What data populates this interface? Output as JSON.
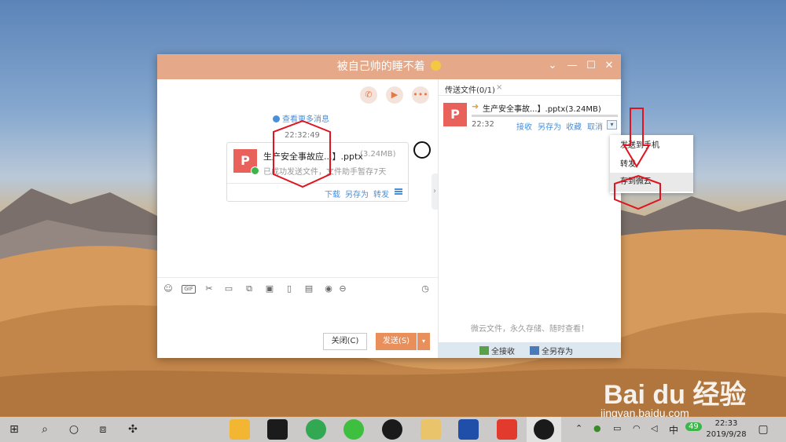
{
  "window": {
    "title": "被自己帅的睡不着",
    "controls": [
      "chevron-down",
      "minimize",
      "maximize",
      "close"
    ]
  },
  "chat": {
    "history_link": "查看更多消息",
    "message_time": "22:32:49",
    "file_card": {
      "name": "生产安全事故应...】.pptx",
      "size": "(3.24MB)",
      "status": "已成功发送文件，文件助手暂存7天",
      "actions": [
        "下载",
        "另存为",
        "转发"
      ]
    },
    "close_button": "关闭(C)",
    "send_button": "发送(S)"
  },
  "transfer_panel": {
    "tab_label": "传送文件(0/1)",
    "tab_close": "×",
    "file_name": "生产安全事故...】.pptx(3.24MB)",
    "time": "22:32",
    "actions": [
      "接收",
      "另存为",
      "收藏",
      "取消"
    ],
    "promo": "微云文件，永久存储、随时查看！",
    "footer": {
      "accept_all": "全接收",
      "save_all": "全另存为"
    }
  },
  "dropdown_menu": {
    "items": [
      "发送到手机",
      "转发",
      "存到微云"
    ],
    "highlighted": "存到微云"
  },
  "watermark": {
    "brand": "Bai du 经验",
    "url": "jingyan.baidu.com"
  },
  "taskbar": {
    "ime": "中",
    "badge": "49",
    "time": "22:33",
    "date": "2019/9/28"
  },
  "colors": {
    "titlebar": "#e5a98a",
    "accent": "#e98f5c",
    "link": "#4a90d9",
    "annotation": "#e0141e"
  }
}
